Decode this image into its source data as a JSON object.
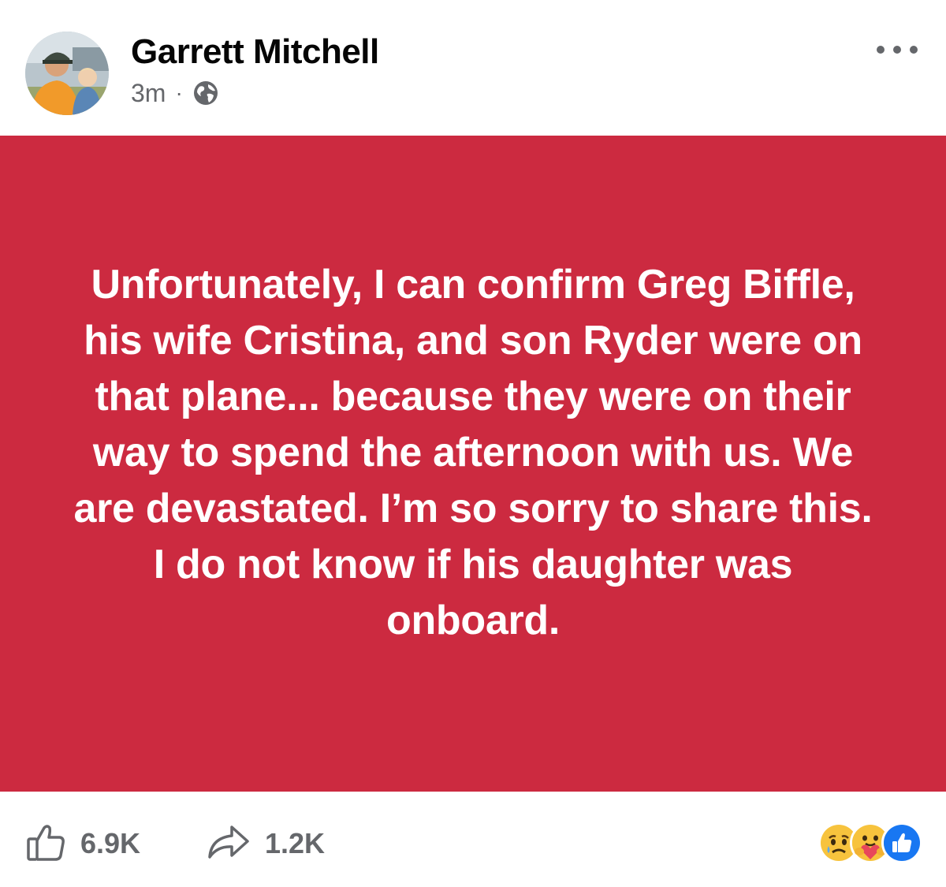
{
  "post": {
    "author": "Garrett Mitchell",
    "timestamp": "3m",
    "separator": "·",
    "privacy_icon": "globe-icon",
    "more_icon": "more-options-icon",
    "status_text": "Unfortunately, I can confirm Greg Biffle, his wife Cristina, and son Ryder were on that plane... because they were on their way to spend the afternoon with us. We are devastated. I’m so sorry to share this. I do not know if his daughter was onboard.",
    "background_color": "#cc2a40"
  },
  "footer": {
    "like_icon": "thumbs-up-icon",
    "like_count": "6.9K",
    "share_icon": "share-arrow-icon",
    "share_count": "1.2K",
    "reactions": [
      "sad-reaction-icon",
      "care-reaction-icon",
      "like-reaction-icon"
    ]
  },
  "colors": {
    "text_primary": "#050505",
    "text_secondary": "#65676b",
    "like_blue": "#1877f2",
    "reaction_yellow": "#f7c33d"
  }
}
